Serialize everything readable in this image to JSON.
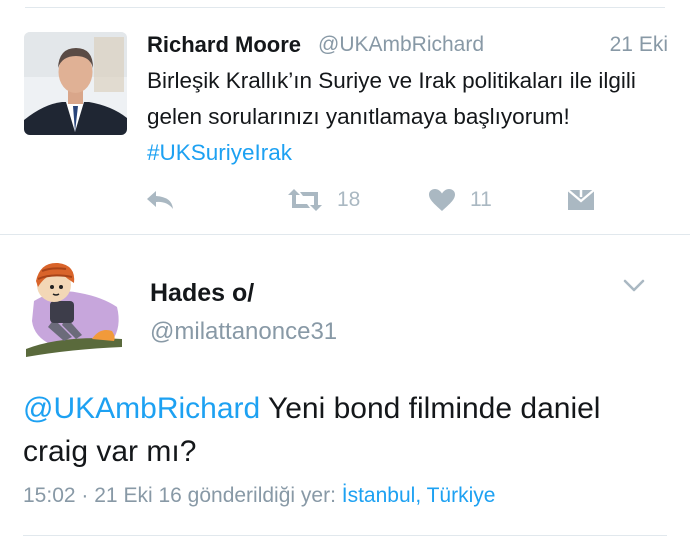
{
  "parent_tweet": {
    "name": "Richard Moore",
    "handle": "@UKAmbRichard",
    "date": "21 Eki",
    "text": "Birleşik Krallık’ın Suriye ve Irak politikaları ile ilgili gelen sorularınızı yanıtlamaya başlıyorum! ",
    "hashtag": "#UKSuriyeIrak",
    "retweet_count": "18",
    "like_count": "11",
    "icons": [
      "reply-icon",
      "retweet-icon",
      "heart-icon",
      "direct-message-icon"
    ]
  },
  "focused_tweet": {
    "name": "Hades o/",
    "handle": "@milattanonce31",
    "mention": "@UKAmbRichard",
    "text": " Yeni bond filminde daniel craig var mı?",
    "time": "15:02",
    "separator": "·",
    "date": "21 Eki 16",
    "location_prefix": "gönderildiği yer:",
    "location": "İstanbul, Türkiye",
    "icons": [
      "chevron-down-icon"
    ]
  },
  "colors": {
    "link": "#1da1f2",
    "secondary_text": "#8899a6",
    "action_icon": "#aab8c2",
    "divider": "#e1e8ed"
  }
}
